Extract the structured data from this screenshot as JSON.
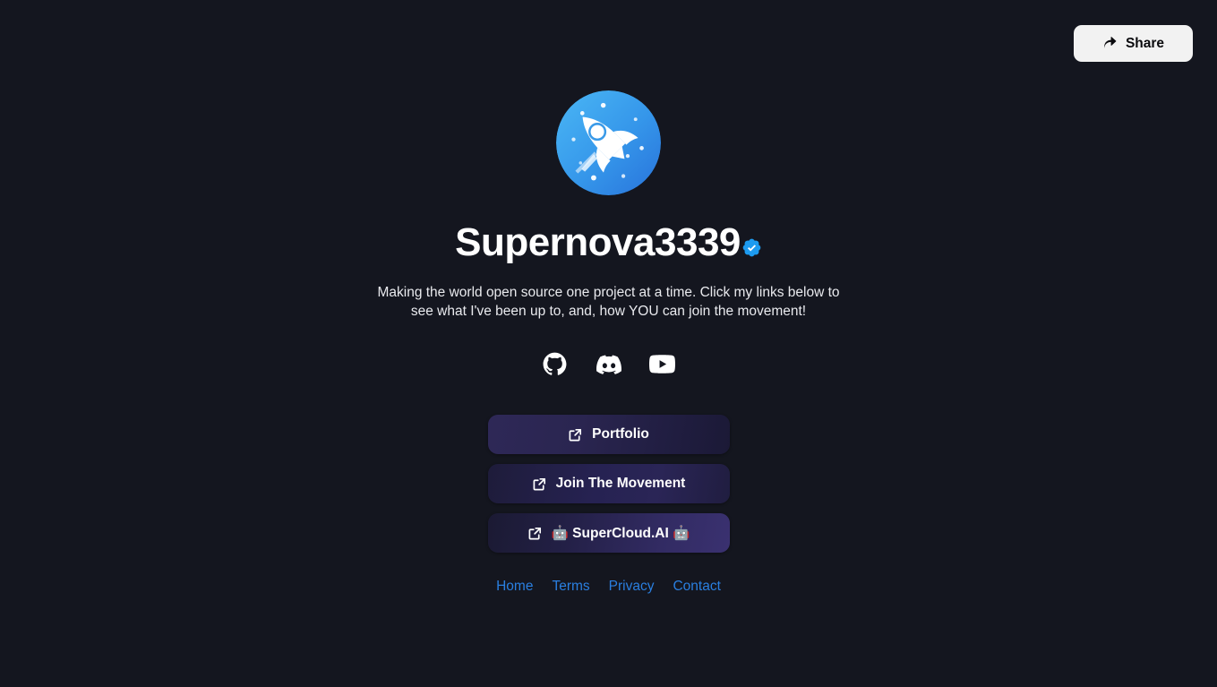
{
  "theme": {
    "background": "#14161f",
    "text": "#ffffff",
    "link_blue": "#2a7fe0",
    "verified_blue": "#1d9bf0",
    "share_bg": "#f2f2f2",
    "avatar_gradient_from": "#49b4f2",
    "avatar_gradient_to": "#2a79de"
  },
  "header": {
    "share_label": "Share",
    "share_icon": "share-arrow-icon"
  },
  "profile": {
    "avatar_icon": "rocket-avatar-icon",
    "display_name": "Supernova3339",
    "verified": true,
    "verified_icon": "verified-badge-icon",
    "bio": "Making the world open source one project at a time. Click my links below to see what I've been up to, and, how YOU can join the movement!"
  },
  "socials": [
    {
      "name": "github",
      "icon": "github-icon",
      "label": "GitHub"
    },
    {
      "name": "discord",
      "icon": "discord-icon",
      "label": "Discord"
    },
    {
      "name": "youtube",
      "icon": "youtube-icon",
      "label": "YouTube"
    }
  ],
  "links": [
    {
      "label": "Portfolio",
      "icon": "external-link-icon"
    },
    {
      "label": "Join The Movement",
      "icon": "external-link-icon"
    },
    {
      "label": "🤖 SuperCloud.AI 🤖",
      "icon": "external-link-icon"
    }
  ],
  "footer": [
    {
      "label": "Home"
    },
    {
      "label": "Terms"
    },
    {
      "label": "Privacy"
    },
    {
      "label": "Contact"
    }
  ]
}
